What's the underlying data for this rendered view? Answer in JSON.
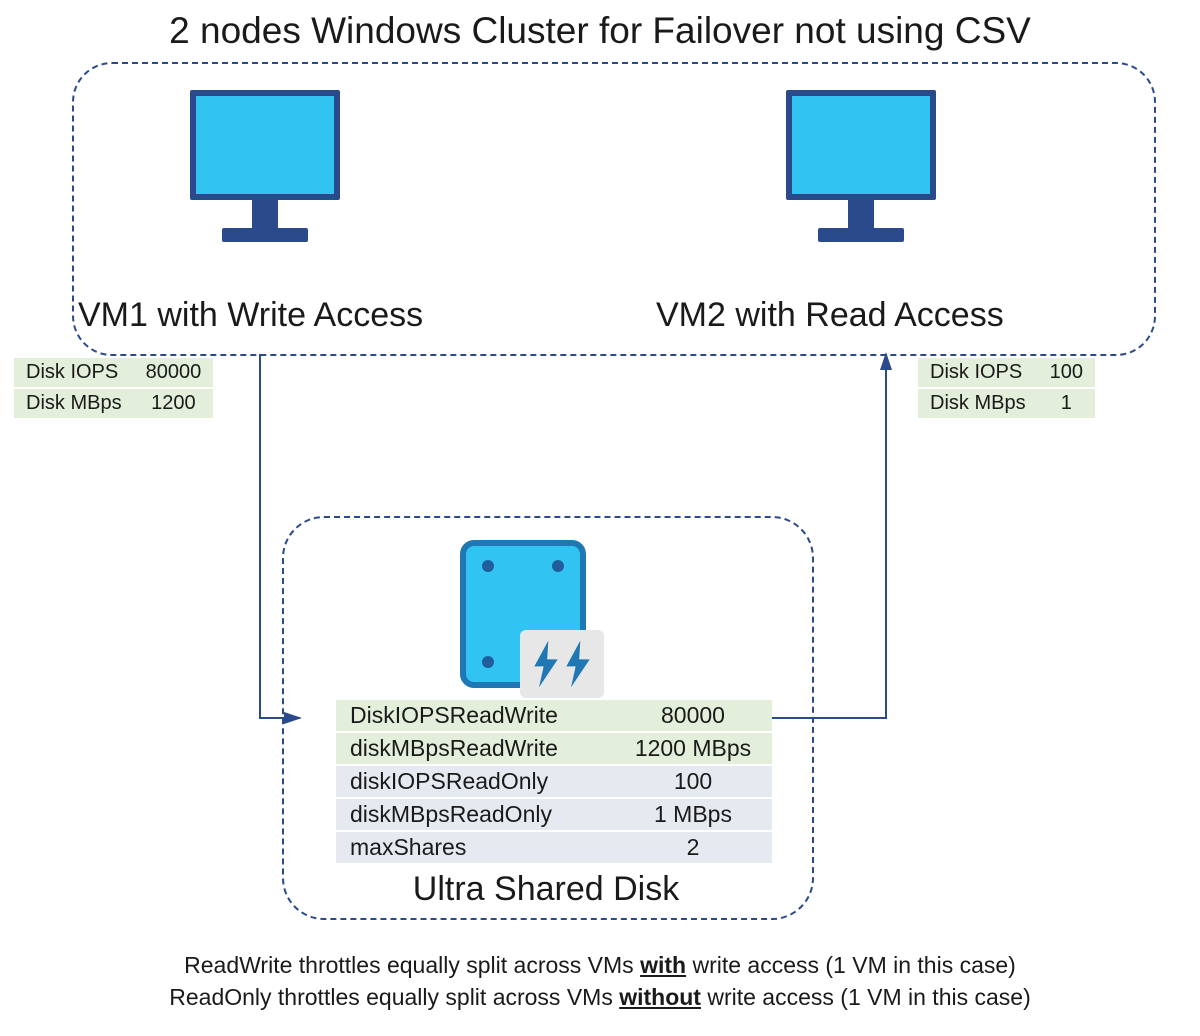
{
  "title": "2 nodes Windows Cluster for Failover not using CSV",
  "vm1": {
    "label": "VM1 with Write Access",
    "iops_label": "Disk IOPS",
    "iops_value": "80000",
    "mbps_label": "Disk MBps",
    "mbps_value": "1200"
  },
  "vm2": {
    "label": "VM2 with Read Access",
    "iops_label": "Disk IOPS",
    "iops_value": "100",
    "mbps_label": "Disk MBps",
    "mbps_value": "1"
  },
  "disk": {
    "title": "Ultra Shared Disk",
    "rows": [
      {
        "label": "DiskIOPSReadWrite",
        "value": "80000"
      },
      {
        "label": "diskMBpsReadWrite",
        "value": "1200 MBps"
      },
      {
        "label": "diskIOPSReadOnly",
        "value": "100"
      },
      {
        "label": "diskMBpsReadOnly",
        "value": "1 MBps"
      },
      {
        "label": "maxShares",
        "value": "2"
      }
    ]
  },
  "caption": {
    "l1a": "ReadWrite throttles equally split across VMs ",
    "l1b": "with",
    "l1c": " write access (1 VM in this case)",
    "l2a": "ReadOnly throttles equally split across VMs ",
    "l2b": "without",
    "l2c": " write access (1 VM in this case)"
  }
}
